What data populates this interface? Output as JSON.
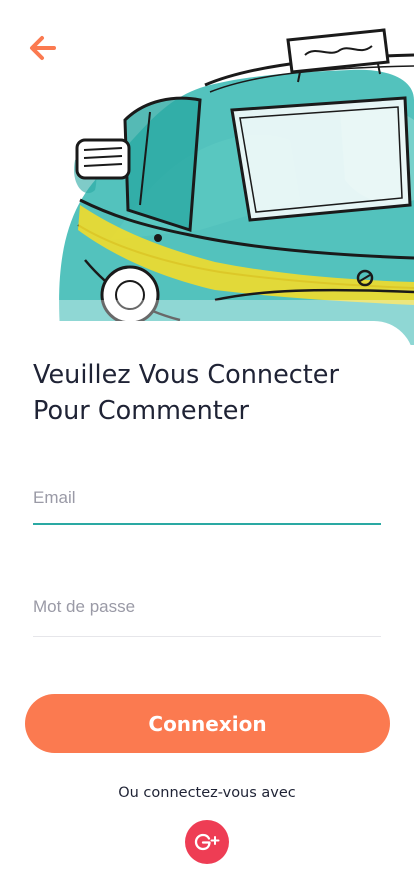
{
  "header": {
    "back_icon": "arrow-left-icon",
    "accent_color": "#fb7a50",
    "hero_image": "taxi-illustration"
  },
  "login": {
    "title": "Veuillez Vous Connecter Pour Commenter",
    "email_placeholder": "Email",
    "password_placeholder": "Mot de passe",
    "submit_label": "Connexion",
    "alt_text": "Ou connectez-vous avec",
    "social_icon": "google-plus-icon",
    "social_color": "#ee3d54",
    "input_focus_color": "#2aa9a3"
  }
}
